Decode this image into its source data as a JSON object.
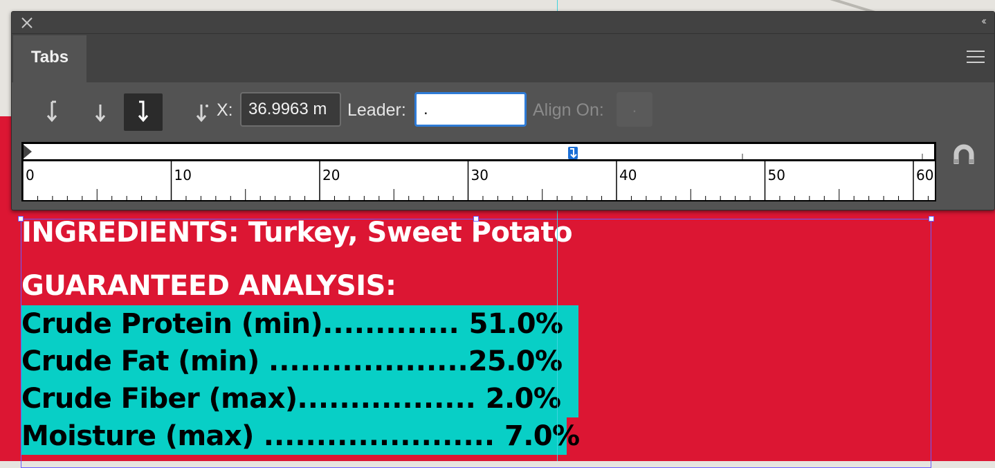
{
  "panel": {
    "tab_label": "Tabs",
    "collapse_label": "‹‹",
    "x_label": "X:",
    "x_value": "36.9963 m",
    "leader_label": "Leader:",
    "leader_value": ".",
    "align_on_label": "Align On:",
    "align_on_value": ".",
    "tool_icons": [
      "left-justified-tab-icon",
      "center-justified-tab-icon",
      "right-justified-tab-icon",
      "align-to-decimal-tab-icon"
    ],
    "selected_tool": "right-justified-tab-icon"
  },
  "ruler": {
    "labels": [
      "0",
      "10",
      "20",
      "30",
      "40",
      "50",
      "60"
    ],
    "tab_stop_position": 36.9963
  },
  "document": {
    "ingredients_line": "INGREDIENTS: Turkey, Sweet Potato",
    "analysis_heading": "GUARANTEED ANALYSIS:",
    "rows": [
      {
        "label": "Crude Protein (min)",
        "leader": "............. ",
        "value": "51.0%"
      },
      {
        "label": "Crude Fat (min) ",
        "leader": " ...................",
        "value": "25.0%"
      },
      {
        "label": "Crude Fiber (max)",
        "leader": "................. ",
        "value": "2.0%"
      },
      {
        "label": "Moisture (max)",
        "leader": " ...................... ",
        "value": "7.0%"
      }
    ]
  },
  "colors": {
    "panel_bg": "#535353",
    "page_red": "#dc1633",
    "highlight": "#08cfc6",
    "accent_blue": "#2e7bd6",
    "frame_outline": "#6a5cff"
  }
}
